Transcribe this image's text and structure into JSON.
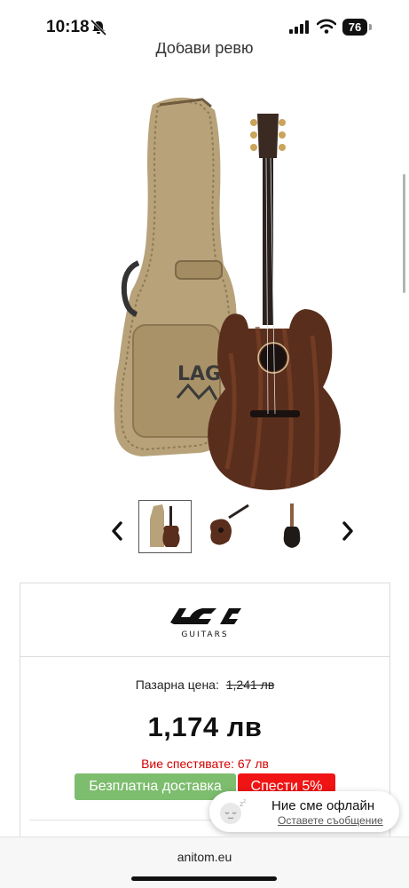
{
  "status_bar": {
    "time": "10:18",
    "battery": "76"
  },
  "page_heading": "Добави ревю",
  "product_image_alt": "LAG guitar with gig bag",
  "carousel": {
    "prev_icon": "chevron-left-icon",
    "next_icon": "chevron-right-icon"
  },
  "brand": {
    "name": "LAG",
    "sub": "GUITARS"
  },
  "pricing": {
    "market_label": "Пазарна цена:",
    "market_price": "1,241 лв",
    "price": "1,174 лв",
    "savings": "Вие спестявате: 67 лв",
    "free_shipping": "Безплатна доставка",
    "save_percent": "Спести 5%"
  },
  "chat": {
    "title": "Ние сме офлайн",
    "link": "Оставете съобщение"
  },
  "browser": {
    "url": "anitom.eu"
  },
  "colors": {
    "green_badge": "#7dbd6e",
    "red_badge": "#f01414",
    "savings_text": "#d40000"
  }
}
